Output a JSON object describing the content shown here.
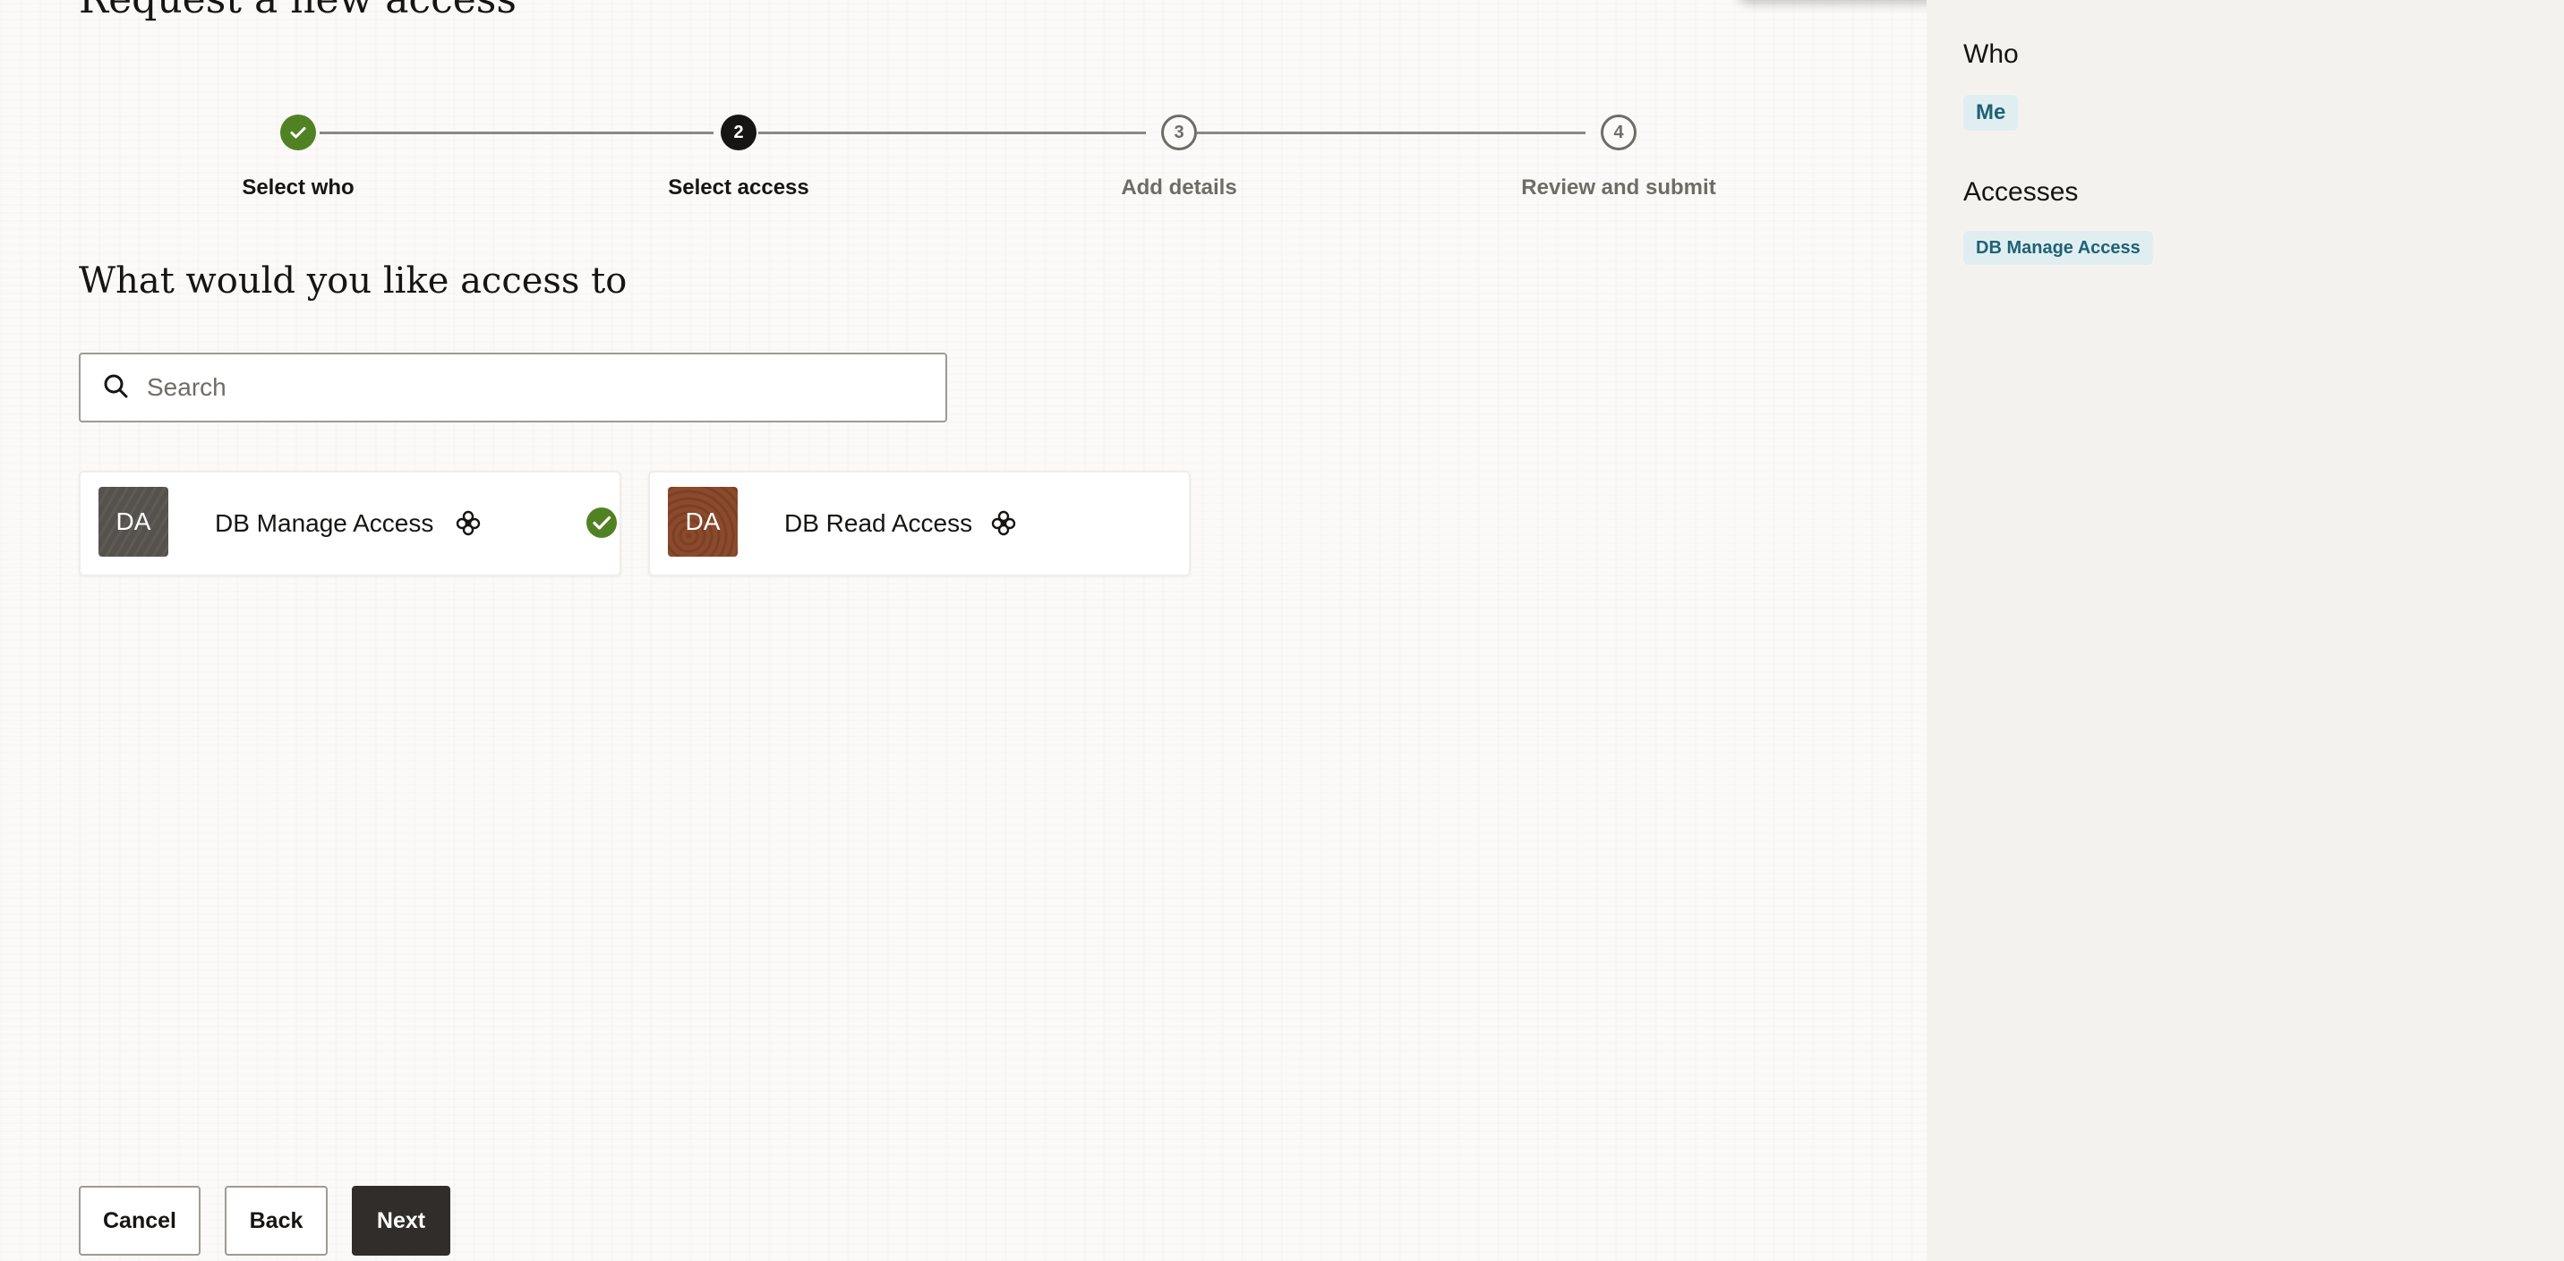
{
  "page": {
    "title": "Request a new access",
    "section_title": "What would you like access to"
  },
  "stepper": {
    "steps": [
      {
        "number": "1",
        "label": "Select who",
        "state": "completed"
      },
      {
        "number": "2",
        "label": "Select access",
        "state": "current"
      },
      {
        "number": "3",
        "label": "Add details",
        "state": "upcoming"
      },
      {
        "number": "4",
        "label": "Review and submit",
        "state": "upcoming"
      }
    ]
  },
  "search": {
    "placeholder": "Search",
    "value": ""
  },
  "access_cards": [
    {
      "initials": "DA",
      "label": "DB Manage Access",
      "selected": true,
      "avatar_color": "#55514d",
      "type_icon": "bundle-icon"
    },
    {
      "initials": "DA",
      "label": "DB Read Access",
      "selected": false,
      "avatar_color": "#8b4a2b",
      "type_icon": "bundle-icon"
    }
  ],
  "footer": {
    "cancel_label": "Cancel",
    "back_label": "Back",
    "next_label": "Next"
  },
  "summary_panel": {
    "who_heading": "Who",
    "who_value": "Me",
    "accesses_heading": "Accesses",
    "accesses": [
      "DB Manage Access"
    ]
  },
  "colors": {
    "completed": "#508223",
    "current": "#161513",
    "chip_bg": "#e1eef1",
    "chip_text": "#1d6275",
    "primary_button": "#312d2a"
  }
}
